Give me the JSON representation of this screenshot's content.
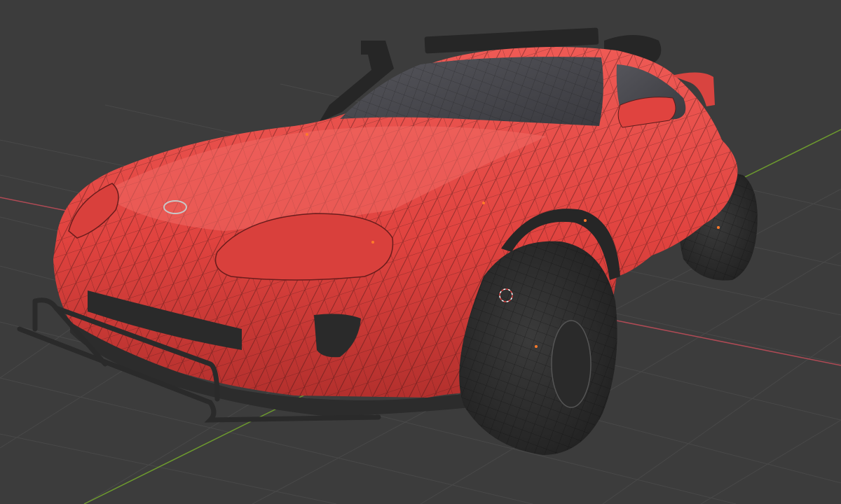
{
  "viewport": {
    "kind": "3d-viewport",
    "display_mode": "solid-with-wireframe-overlay",
    "background_color": "#3c3c3c",
    "grid_color": "#4a4a4a",
    "x_axis_color": "#b04a55",
    "y_axis_color": "#6d9a2e"
  },
  "scene": {
    "object": "car-model",
    "body_color": "#e0433f",
    "body_shadow_color": "#a92a28",
    "wire_color": "#3a1414",
    "tire_color": "#2f2f2f",
    "trim_color": "#262626",
    "glass_color": "#4a4a4f",
    "selection_color": "#ff7a2a",
    "emblem_color": "#c8c8c8"
  },
  "cursor": {
    "icon": "3d-cursor-icon"
  }
}
